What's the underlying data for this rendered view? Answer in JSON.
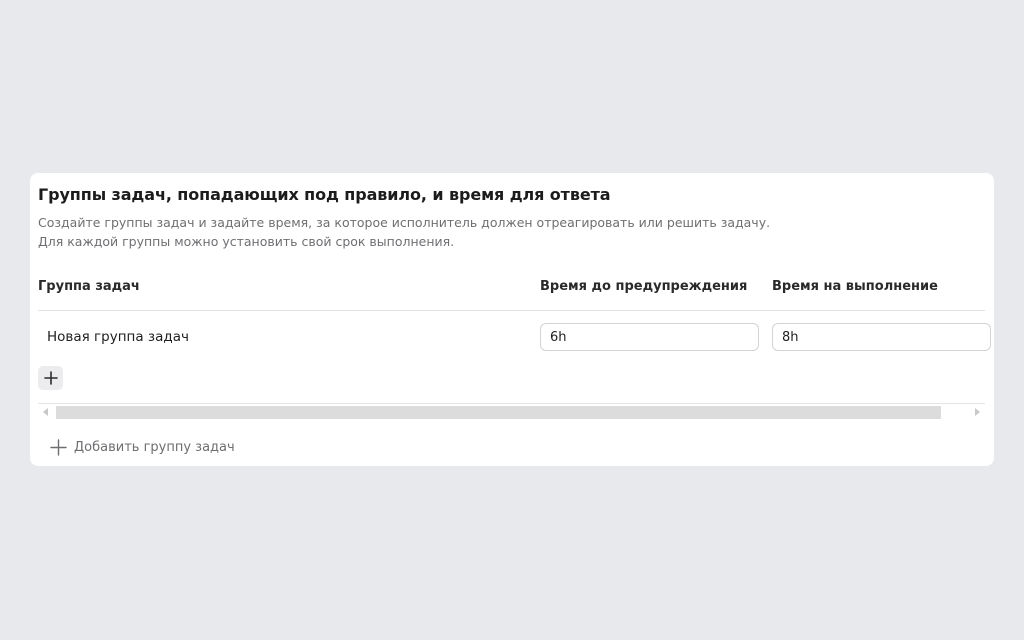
{
  "section": {
    "title": "Группы задач, попадающих под правило, и время для ответа",
    "description_line1": "Создайте группы задач и задайте время, за которое исполнитель должен отреагировать или решить задачу.",
    "description_line2": "Для каждой группы можно установить свой срок выполнения."
  },
  "table": {
    "columns": {
      "group": "Группа задач",
      "warning_time": "Время до предупреждения",
      "completion_time": "Время на выполнение"
    },
    "rows": [
      {
        "name": "Новая группа задач",
        "warning_time": "6h",
        "completion_time": "8h"
      }
    ],
    "add_row_icon": "plus-icon"
  },
  "footer": {
    "add_group_label": "Добавить группу задач",
    "add_group_icon": "plus-icon"
  },
  "colors": {
    "page_background": "#e8e9ec",
    "card_background": "#ffffff",
    "muted_text": "#6f6f73"
  }
}
